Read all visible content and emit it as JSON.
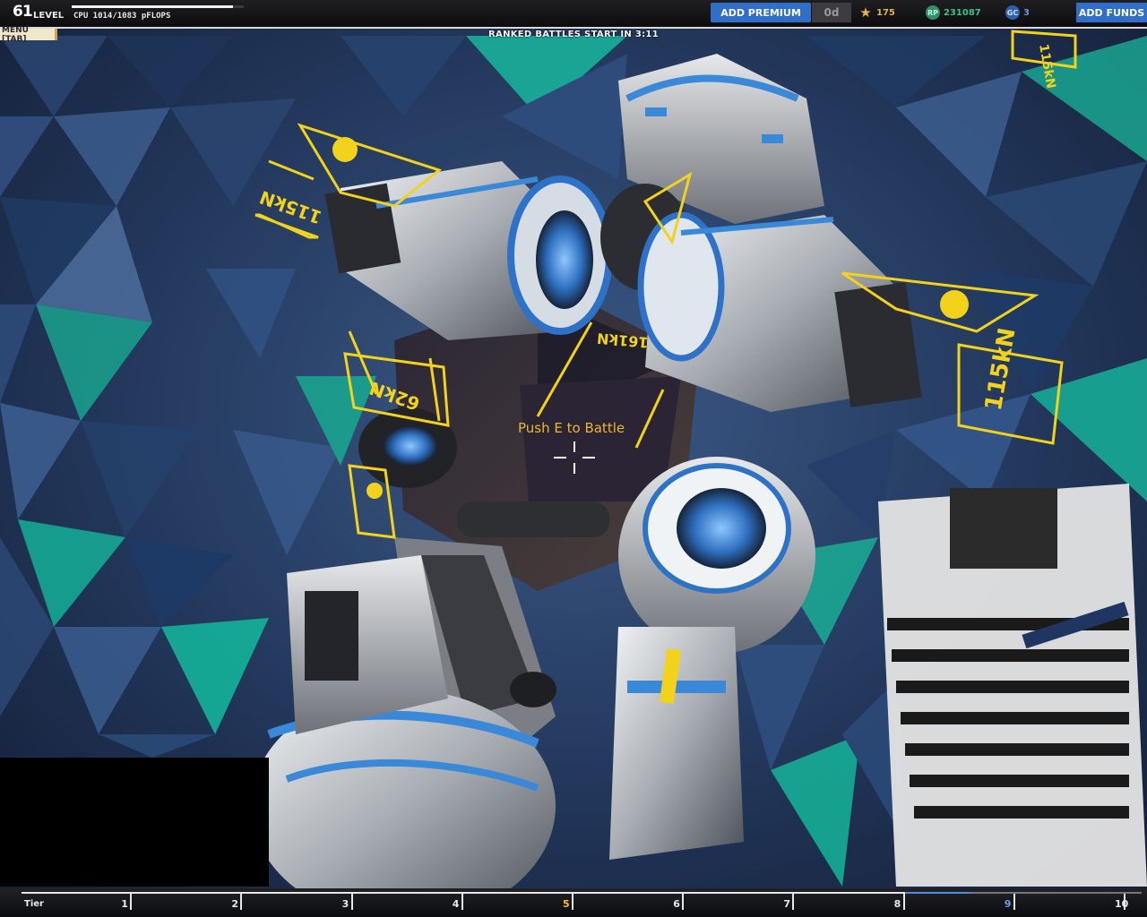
{
  "hud": {
    "level": "61",
    "level_label": "LEVEL",
    "cpu_text": "CPU 1014/1083 pFLOPS",
    "cpu_fraction": 0.936,
    "premium_button": "ADD PREMIUM",
    "premium_days": "0d",
    "stars": "175",
    "rp": "231087",
    "gc": "3",
    "funds_button": "ADD FUNDS",
    "menu_tab": "MENU [TAB]",
    "ranked_notice": "RANKED BATTLES START IN 3:11"
  },
  "scene": {
    "prompt": "Push E to Battle",
    "thrust_labels": [
      "115kN",
      "115kN",
      "115kN",
      "62kN",
      "161kN"
    ]
  },
  "tier_bar": {
    "label": "Tier",
    "ticks": [
      "1",
      "2",
      "3",
      "4",
      "5",
      "6",
      "7",
      "8",
      "9",
      "10"
    ],
    "current_tier": "9",
    "progress_fraction": 0.86
  },
  "icons": {
    "star": "star-icon",
    "rp": "robot-points-icon",
    "gc": "galaxy-coin-icon",
    "crosshair": "crosshair-icon"
  },
  "colors": {
    "accent_blue": "#2f6fc9",
    "hud_yellow": "#f2d21a",
    "prompt_orange": "#e8b44a",
    "tier_active": "#6d9ce8"
  }
}
